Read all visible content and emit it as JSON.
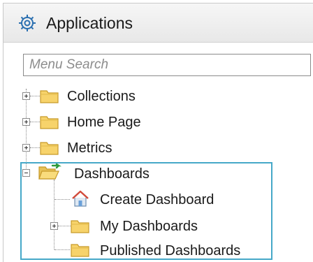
{
  "panel": {
    "title": "Applications",
    "title_icon": "gear-icon",
    "search": {
      "placeholder": "Menu Search",
      "value": ""
    }
  },
  "tree": {
    "items": [
      {
        "label": "Collections",
        "icon": "folder-icon",
        "expander": "plus"
      },
      {
        "label": "Home Page",
        "icon": "folder-icon",
        "expander": "plus"
      },
      {
        "label": "Metrics",
        "icon": "folder-icon",
        "expander": "plus"
      },
      {
        "label": "Dashboards",
        "icon": "open-folder-icon",
        "expander": "minus",
        "children": [
          {
            "label": "Create Dashboard",
            "icon": "home-icon"
          },
          {
            "label": "My Dashboards",
            "icon": "folder-icon",
            "expander": "plus"
          },
          {
            "label": "Published Dashboards",
            "icon": "folder-icon"
          }
        ]
      }
    ]
  },
  "colors": {
    "highlight": "#46a8c8",
    "folder": "#f7d36b",
    "folder_edge": "#c79a2a"
  }
}
